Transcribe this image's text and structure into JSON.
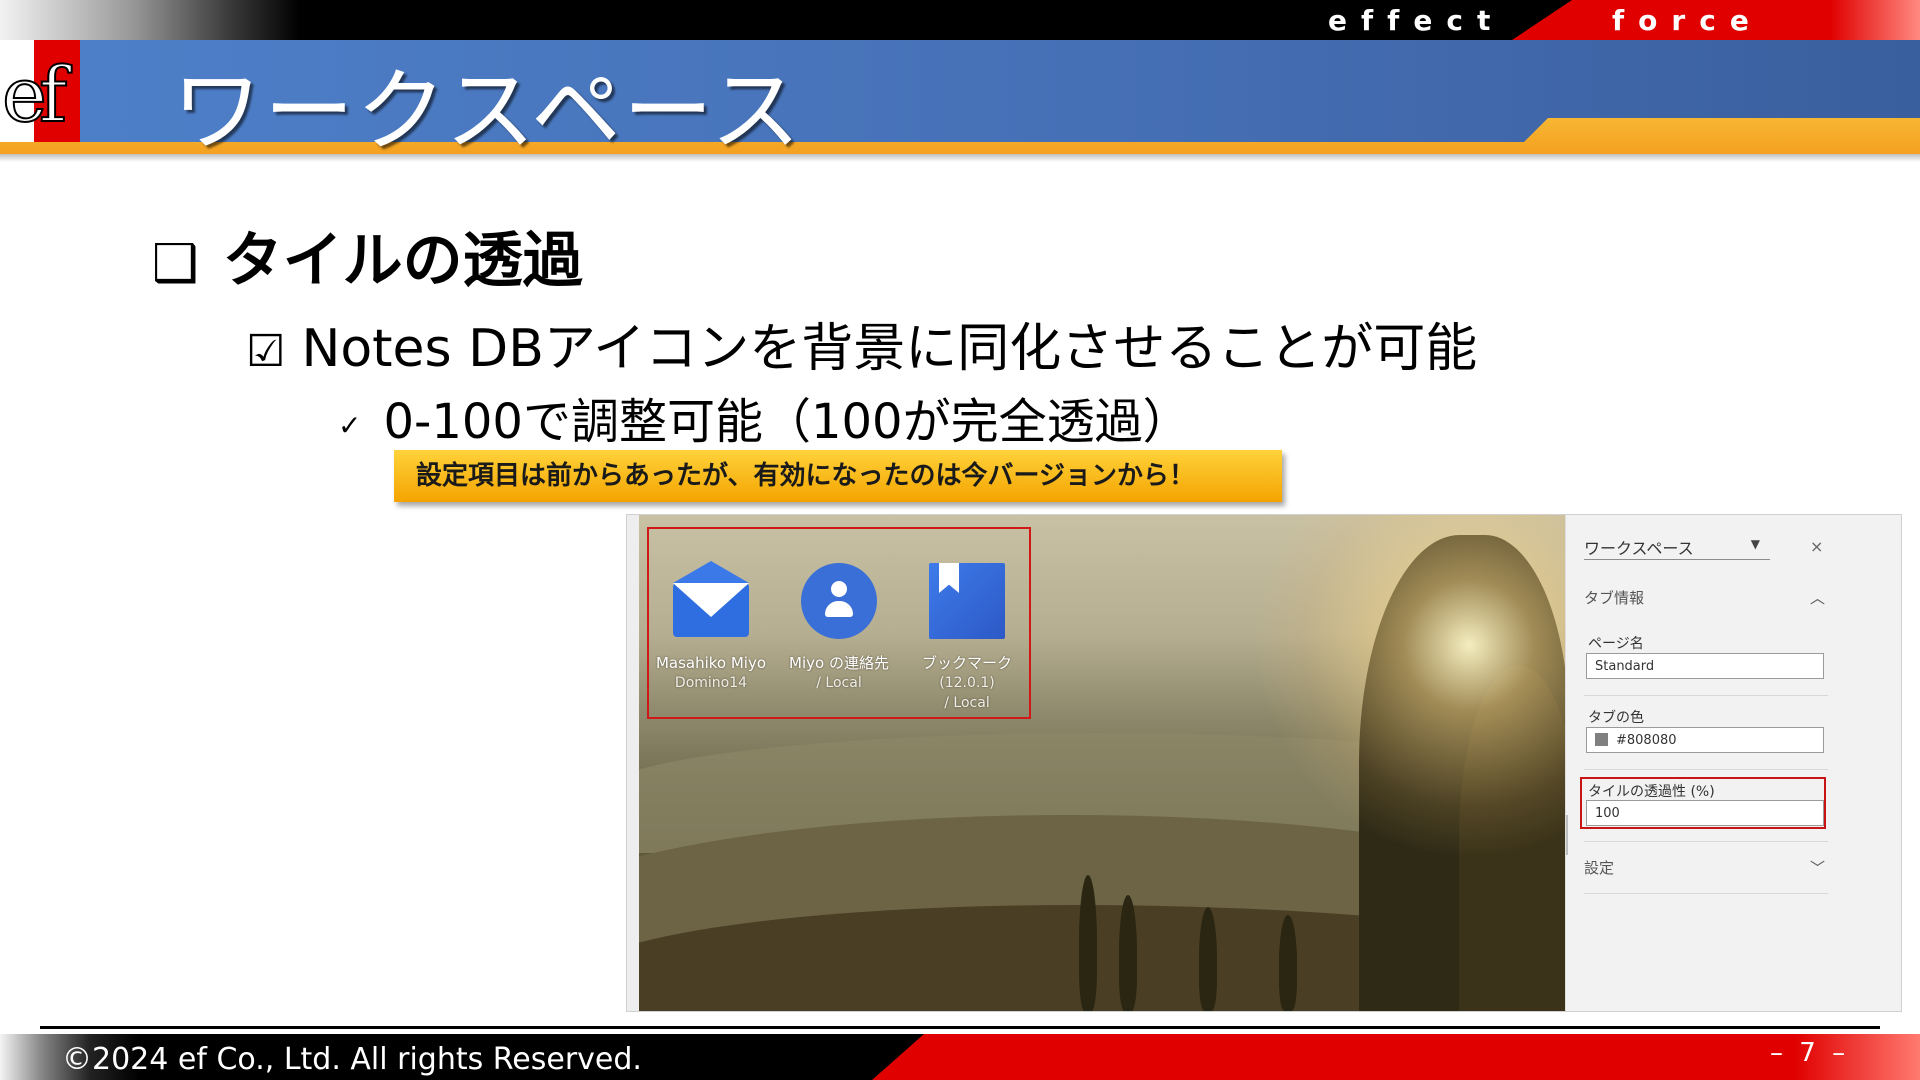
{
  "header": {
    "brand_left": "effect",
    "brand_right": "force",
    "logo_text": "ef",
    "title": "ワークスペース"
  },
  "content": {
    "heading": "タイルの透過",
    "heading_bullet": "❑",
    "point": "Notes DBアイコンを背景に同化させることが可能",
    "point_bullet": "☑",
    "subpoint": "0-100で調整可能（100が完全透過）",
    "subpoint_bullet": "✓",
    "note": "設定項目は前からあったが、有効になったのは今バージョンから！"
  },
  "screenshot": {
    "tiles": [
      {
        "name": "Masahiko Miyo",
        "sub": "Domino14",
        "icon": "mail-icon"
      },
      {
        "name": "Miyo の連絡先",
        "sub": "/ Local",
        "icon": "contact-icon"
      },
      {
        "name": "ブックマーク",
        "sub": "(12.0.1)",
        "sub2": "/ Local",
        "icon": "bookmark-icon"
      }
    ],
    "panel": {
      "select_value": "ワークスペース",
      "select_arrow": "▼",
      "close": "×",
      "section_tab_info": "タブ情報",
      "section_tab_info_chevron": "︿",
      "page_name_label": "ページ名",
      "page_name_value": "Standard",
      "tab_color_label": "タブの色",
      "tab_color_value": "#808080",
      "tile_transparency_label": "タイルの透過性 (%)",
      "tile_transparency_value": "100",
      "section_settings": "設定",
      "section_settings_chevron": "﹀"
    }
  },
  "footer": {
    "copyright": "©2024 ef Co., Ltd.  All rights Reserved.",
    "page": "– 7 –"
  },
  "colors": {
    "header_blue": "#4670b6",
    "accent_red": "#e00000",
    "accent_orange": "#f4a020",
    "note_yellow": "#ffd23a",
    "highlight_red": "#d01818"
  }
}
